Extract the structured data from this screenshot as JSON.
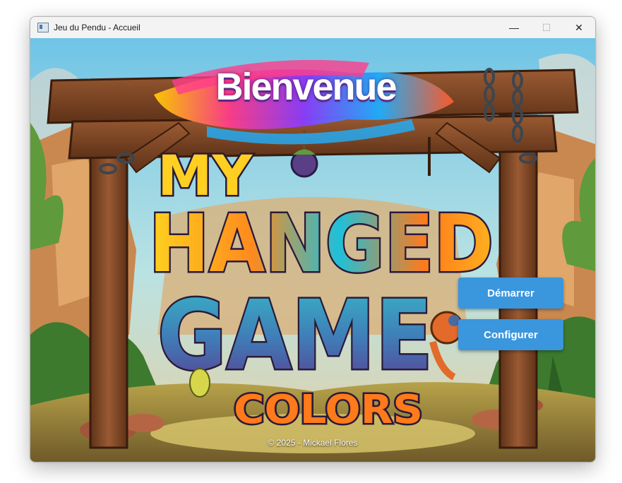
{
  "window": {
    "title": "Jeu du Pendu - Accueil",
    "controls": {
      "minimize": "—",
      "maximize": "☐",
      "close": "✕"
    }
  },
  "header": {
    "welcome": "Bienvenue"
  },
  "logo": {
    "line1": "MY",
    "line2": "HANGED",
    "line3": "GAME",
    "line4": "COLORS"
  },
  "actions": {
    "start_label": "Démarrer",
    "config_label": "Configurer"
  },
  "footer": {
    "copyright": "© 2025 - Mickael Flores"
  },
  "icons": [
    "app-icon",
    "minimize-icon",
    "maximize-icon",
    "close-icon"
  ],
  "colors": {
    "button": "#3a96dd",
    "button_text": "#ffffff",
    "titlebar": "#f3f3f3"
  }
}
